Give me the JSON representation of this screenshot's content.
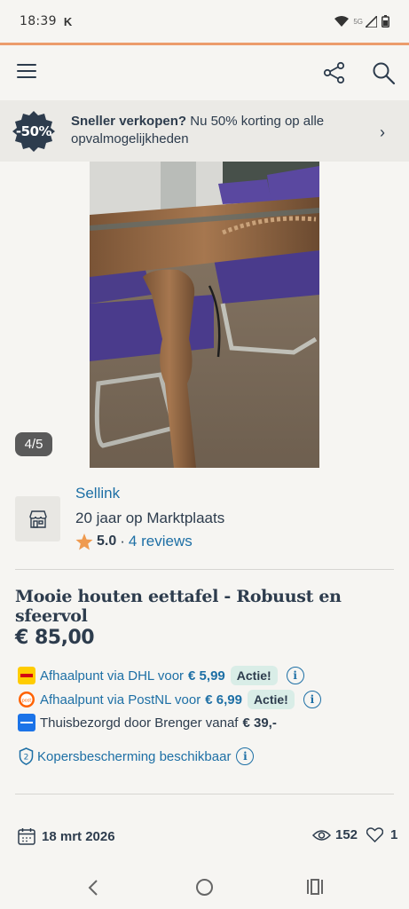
{
  "status_bar": {
    "time": "18:39",
    "carrier_letter": "K",
    "network": "5G"
  },
  "app_bar": {
    "menu_icon": "hamburger-icon",
    "share_icon": "share-icon",
    "search_icon": "search-icon"
  },
  "promo": {
    "badge": "-50%",
    "headline": "Sneller verkopen?",
    "body": " Nu 50% korting op alle opvalmogelijkheden",
    "chevron": "›",
    "accent_color": "#2d3c4d"
  },
  "gallery": {
    "counter": "4/5"
  },
  "seller": {
    "name": "Sellink",
    "years": "20 jaar op Marktplaats",
    "rating": "5.0",
    "separator": "·",
    "reviews": "4 reviews",
    "avatar_icon": "store-icon"
  },
  "listing": {
    "title": "Mooie houten eettafel - Robuust en sfeervol",
    "price": "€ 85,00"
  },
  "shipping": [
    {
      "logo": "dhl-logo",
      "label": "Afhaalpunt via DHL voor",
      "price": "€ 5,99",
      "badge": "Actie!"
    },
    {
      "logo": "postnl-logo",
      "label": "Afhaalpunt via PostNL voor",
      "price": "€ 6,99",
      "badge": "Actie!"
    },
    {
      "logo": "brenger-logo",
      "label": "Thuisbezorgd door Brenger vanaf",
      "price": "€ 39,-"
    }
  ],
  "buyer_protection": {
    "label": "Kopersbescherming beschikbaar"
  },
  "meta": {
    "date": "18 mrt 2026",
    "views": "152",
    "favorites": "1"
  },
  "colors": {
    "link": "#1d6fa5",
    "text": "#2d3c4d",
    "accent": "#ec9c6c",
    "badge_bg": "#d9ede7"
  }
}
